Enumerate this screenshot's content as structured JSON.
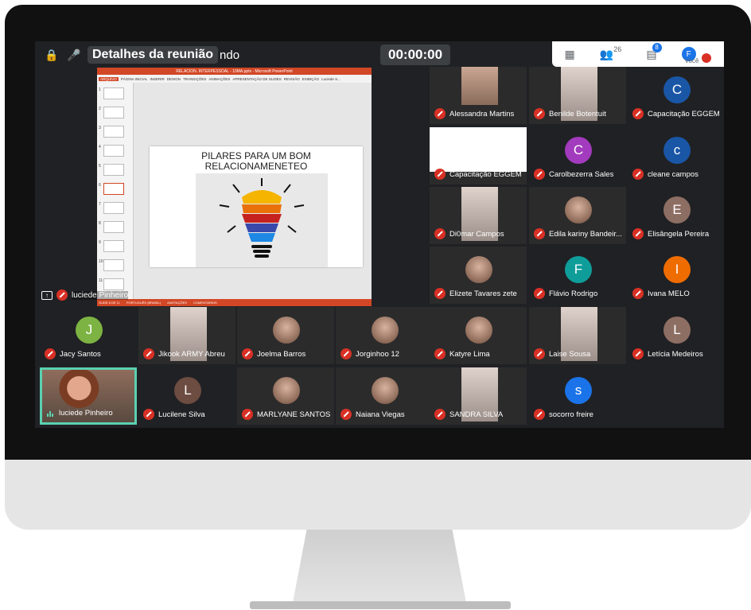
{
  "meeting": {
    "title": "Detalhes da reunião",
    "title_tail": "ndo",
    "timer": "00:00:00",
    "people_count": "26",
    "chat_count": "8",
    "you_initial": "F",
    "you_label": "Você"
  },
  "presentation": {
    "window_title": "RELACION. INTERPESSOAL - 10MA.pptx - Microsoft PowerPoint",
    "ribbon_tabs": [
      "ARQUIVO",
      "PÁGINA INICIAL",
      "INSERIR",
      "DESIGN",
      "TRANSIÇÕES",
      "ANIMAÇÕES",
      "APRESENTAÇÃO DE SLIDES",
      "REVISÃO",
      "EXIBIÇÃO",
      "Luciede S..."
    ],
    "slide_title_line1": "PILARES PARA UM BOM",
    "slide_title_line2": "RELACIONAMENETEO",
    "thumb_numbers": [
      "1",
      "2",
      "3",
      "4",
      "5",
      "6",
      "7",
      "8",
      "9",
      "10",
      "11"
    ],
    "status_left": "SLIDE 6 DE 11",
    "status_mid": "PORTUGUÊS (BRASIL)",
    "status_notes": "ANOTAÇÕES",
    "status_comments": "COMENTÁRIOS",
    "presenter_name": "luciede Pinheiro"
  },
  "participants": [
    {
      "name": "Alessandra Martins",
      "kind": "photo"
    },
    {
      "name": "Benilde Botentuit",
      "kind": "photo-tall"
    },
    {
      "name": "Capacitação EGGEM",
      "kind": "letter",
      "letter": "C",
      "color": "#1a56a6"
    },
    {
      "name": "Capacitação EGGEM",
      "kind": "screen"
    },
    {
      "name": "Carolbezerra Sales",
      "kind": "letter",
      "letter": "C",
      "color": "#a23bbd"
    },
    {
      "name": "cleane campos",
      "kind": "letter",
      "letter": "c",
      "color": "#1a56a6"
    },
    {
      "name": "Di0mar Campos",
      "kind": "photo-tall"
    },
    {
      "name": "Edila kariny Bandeir...",
      "kind": "circle"
    },
    {
      "name": "Elisângela Pereira",
      "kind": "letter",
      "letter": "E",
      "color": "#8d6e63"
    },
    {
      "name": "Elizete Tavares zete",
      "kind": "circle"
    },
    {
      "name": "Flávio Rodrigo",
      "kind": "letter",
      "letter": "F",
      "color": "#0f9d9a"
    },
    {
      "name": "Ivana MELO",
      "kind": "letter",
      "letter": "I",
      "color": "#ef6c00"
    },
    {
      "name": "Jacy Santos",
      "kind": "letter",
      "letter": "J",
      "color": "#7cb342"
    },
    {
      "name": "Jikook ARMY Abreu",
      "kind": "photo-tall"
    },
    {
      "name": "Joelma Barros",
      "kind": "circle"
    },
    {
      "name": "Jorginhoo 12",
      "kind": "circle"
    },
    {
      "name": "Katyre Lima",
      "kind": "circle"
    },
    {
      "name": "Laise Sousa",
      "kind": "photo-tall"
    },
    {
      "name": "Letícia Medeiros",
      "kind": "letter",
      "letter": "L",
      "color": "#8d6e63"
    },
    {
      "name": "luciede Pinheiro",
      "kind": "active"
    },
    {
      "name": "Lucilene Silva",
      "kind": "letter",
      "letter": "L",
      "color": "#6d4c41"
    },
    {
      "name": "MARLYANE SANTOS",
      "kind": "circle"
    },
    {
      "name": "Naiana Viegas",
      "kind": "circle"
    },
    {
      "name": "SANDRA SILVA",
      "kind": "photo-tall"
    },
    {
      "name": "socorro freire",
      "kind": "letter",
      "letter": "s",
      "color": "#1a73e8"
    }
  ]
}
